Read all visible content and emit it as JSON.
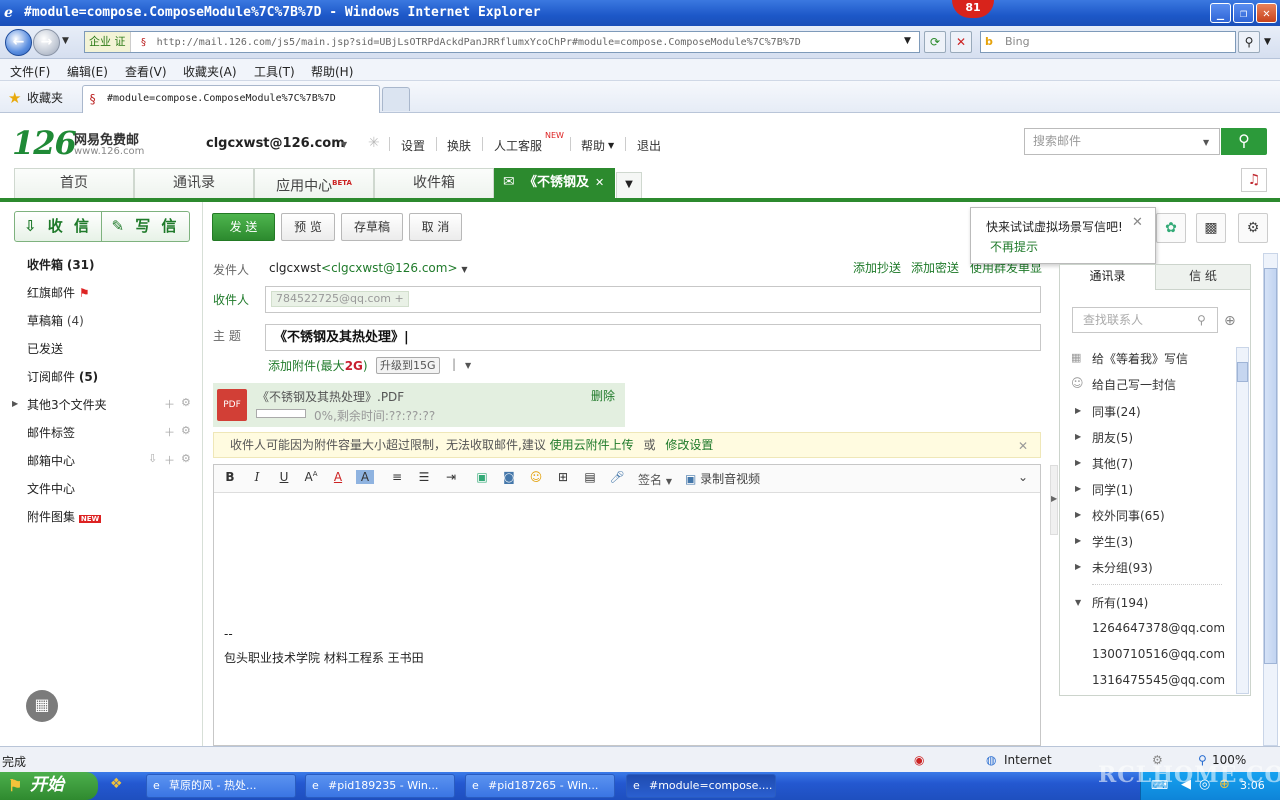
{
  "window": {
    "title": "#module=compose.ComposeModule%7C%7B%7D - Windows Internet Explorer",
    "badge": "81",
    "min": "_",
    "max": "❐",
    "close": "✕"
  },
  "addressbar": {
    "zone": "企业 证",
    "url": "http://mail.126.com/js5/main.jsp?sid=UBjLsOTRPdAckdPanJRRflumxYcoChPr#module=compose.ComposeModule%7C%7B%7D",
    "search_placeholder": "Bing"
  },
  "menubar": [
    "文件(F)",
    "编辑(E)",
    "查看(V)",
    "收藏夹(A)",
    "工具(T)",
    "帮助(H)"
  ],
  "favbar": {
    "label": "收藏夹",
    "tab_title": "#module=compose.ComposeModule%7C%7B%7D"
  },
  "header": {
    "logo": "126",
    "logo_sub": "网易免费邮",
    "logo_domain": "www.126.com",
    "account": "clgcxwst@126.com",
    "links": [
      "设置",
      "换肤",
      "人工客服",
      "帮助",
      "退出"
    ],
    "new_tag": "NEW",
    "search_placeholder": "搜索邮件"
  },
  "nav_tabs": [
    "首页",
    "通讯录",
    "应用中心",
    "收件箱"
  ],
  "beta_tag": "BETA",
  "compose_tab": "《不锈钢及",
  "sidebar": {
    "receive": "收 信",
    "write": "写 信",
    "items": [
      {
        "label": "收件箱",
        "count": "(31)"
      },
      {
        "label": "红旗邮件",
        "count": ""
      },
      {
        "label": "草稿箱",
        "count": "(4)"
      },
      {
        "label": "已发送",
        "count": ""
      },
      {
        "label": "订阅邮件",
        "count": "(5)"
      },
      {
        "label": "其他3个文件夹",
        "count": ""
      },
      {
        "label": "邮件标签",
        "count": ""
      },
      {
        "label": "邮箱中心",
        "count": ""
      },
      {
        "label": "文件中心",
        "count": ""
      },
      {
        "label": "附件图集",
        "count": ""
      }
    ],
    "new_tag": "NEW"
  },
  "compose": {
    "send": "发 送",
    "preview": "预 览",
    "save_draft": "存草稿",
    "cancel": "取 消",
    "from_label": "发件人",
    "from_name": "clgcxwst",
    "from_addr": "<clgcxwst@126.com>",
    "add_cc": "添加抄送",
    "add_bcc": "添加密送",
    "group_single": "使用群发单显",
    "to_label": "收件人",
    "to_chip": "784522725@qq.com +",
    "subject_label": "主  题",
    "subject": "《不锈钢及其热处理》|",
    "attach_pre": "添加附件(最大",
    "attach_size": "2G",
    "attach_post": ")",
    "upgrade": "升级到15G",
    "file_name": "《不锈钢及其热处理》.PDF",
    "progress_text": "0%,剩余时间:??:??:??",
    "progress": 0,
    "delete": "删除",
    "warn_text": "收件人可能因为附件容量大小超过限制，无法收取邮件,建议",
    "warn_link1": "使用云附件上传",
    "warn_or": "或",
    "warn_link2": "修改设置",
    "toolbar_sign": "签名",
    "toolbar_record": "录制音视频",
    "sig_line1": "--",
    "sig_line2": "包头职业技术学院 材料工程系 王书田"
  },
  "popup": {
    "text": "快来试试虚拟场景写信吧!",
    "link": "不再提示"
  },
  "contacts": {
    "tab1": "通讯录",
    "tab2": "信 纸",
    "search_placeholder": "查找联系人",
    "write_star": "给《等着我》写信",
    "write_self": "给自己写一封信",
    "groups": [
      "同事(24)",
      "朋友(5)",
      "其他(7)",
      "同学(1)",
      "校外同事(65)",
      "学生(3)",
      "未分组(93)"
    ],
    "all": "所有(194)",
    "emails": [
      "1264647378@qq.com",
      "1300710516@qq.com",
      "1316475545@qq.com"
    ]
  },
  "statusbar": {
    "left": "完成",
    "zone": "Internet",
    "zoom": "100%"
  },
  "taskbar": {
    "start": "开始",
    "tasks": [
      "草原的风 - 热处...",
      "#pid189235 - Win...",
      "#pid187265 - Win...",
      "#module=compose...."
    ],
    "clock": "3:06",
    "watermark": "RCLHOME.COM"
  }
}
